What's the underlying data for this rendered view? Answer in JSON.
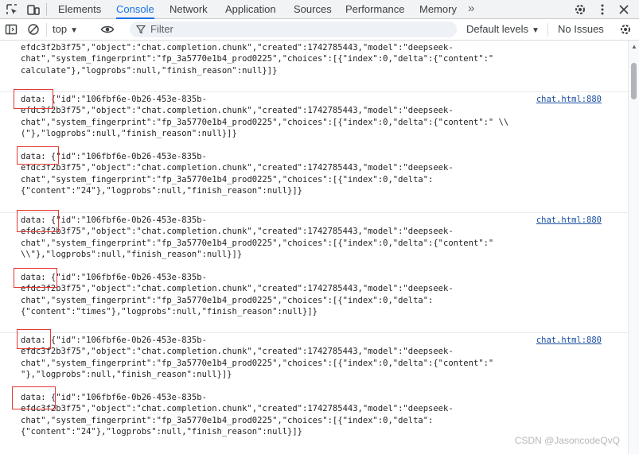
{
  "tabs": [
    "Elements",
    "Console",
    "Network",
    "Application",
    "Sources",
    "Performance",
    "Memory"
  ],
  "more_tabs": "»",
  "toolbar": {
    "context": "top",
    "filter_placeholder": "Filter",
    "levels": "Default levels",
    "issues": "No Issues"
  },
  "icons": {
    "inspect": "inspect-element-icon",
    "device": "device-toolbar-icon",
    "settings": "gear-icon",
    "menu": "kebab-menu-icon",
    "close": "close-icon",
    "sidebar": "sidebar-toggle-icon",
    "clear": "clear-console-icon",
    "eye": "live-expression-icon",
    "filter": "filter-icon",
    "console_settings": "gear-icon"
  },
  "messages": [
    {
      "text": "efdc3f2b3f75\",\"object\":\"chat.completion.chunk\",\"created\":1742785443,\"model\":\"deepseek-\nchat\",\"system_fingerprint\":\"fp_3a5770e1b4_prod0225\",\"choices\":[{\"index\":0,\"delta\":{\"content\":\"\ncalculate\"},\"logprobs\":null,\"finish_reason\":null}]}",
      "source": ""
    },
    {
      "text": "data: {\"id\":\"106fbf6e-0b26-453e-835b-\nefdc3f2b3f75\",\"object\":\"chat.completion.chunk\",\"created\":1742785443,\"model\":\"deepseek-\nchat\",\"system_fingerprint\":\"fp_3a5770e1b4_prod0225\",\"choices\":[{\"index\":0,\"delta\":{\"content\":\" \\\\\n(\"},\"logprobs\":null,\"finish_reason\":null}]}\n\ndata: {\"id\":\"106fbf6e-0b26-453e-835b-\nefdc3f2b3f75\",\"object\":\"chat.completion.chunk\",\"created\":1742785443,\"model\":\"deepseek-\nchat\",\"system_fingerprint\":\"fp_3a5770e1b4_prod0225\",\"choices\":[{\"index\":0,\"delta\":\n{\"content\":\"24\"},\"logprobs\":null,\"finish_reason\":null}]}",
      "source": "chat.html:880"
    },
    {
      "text": "data: {\"id\":\"106fbf6e-0b26-453e-835b-\nefdc3f2b3f75\",\"object\":\"chat.completion.chunk\",\"created\":1742785443,\"model\":\"deepseek-\nchat\",\"system_fingerprint\":\"fp_3a5770e1b4_prod0225\",\"choices\":[{\"index\":0,\"delta\":{\"content\":\"\n\\\\\"},\"logprobs\":null,\"finish_reason\":null}]}\n\ndata: {\"id\":\"106fbf6e-0b26-453e-835b-\nefdc3f2b3f75\",\"object\":\"chat.completion.chunk\",\"created\":1742785443,\"model\":\"deepseek-\nchat\",\"system_fingerprint\":\"fp_3a5770e1b4_prod0225\",\"choices\":[{\"index\":0,\"delta\":\n{\"content\":\"times\"},\"logprobs\":null,\"finish_reason\":null}]}",
      "source": "chat.html:880"
    },
    {
      "text": "data: {\"id\":\"106fbf6e-0b26-453e-835b-\nefdc3f2b3f75\",\"object\":\"chat.completion.chunk\",\"created\":1742785443,\"model\":\"deepseek-\nchat\",\"system_fingerprint\":\"fp_3a5770e1b4_prod0225\",\"choices\":[{\"index\":0,\"delta\":{\"content\":\"\n\"},\"logprobs\":null,\"finish_reason\":null}]}\n\ndata: {\"id\":\"106fbf6e-0b26-453e-835b-\nefdc3f2b3f75\",\"object\":\"chat.completion.chunk\",\"created\":1742785443,\"model\":\"deepseek-\nchat\",\"system_fingerprint\":\"fp_3a5770e1b4_prod0225\",\"choices\":[{\"index\":0,\"delta\":\n{\"content\":\"24\"},\"logprobs\":null,\"finish_reason\":null}]}",
      "source": "chat.html:880"
    }
  ],
  "watermark": "CSDN @JasoncodeQvQ"
}
